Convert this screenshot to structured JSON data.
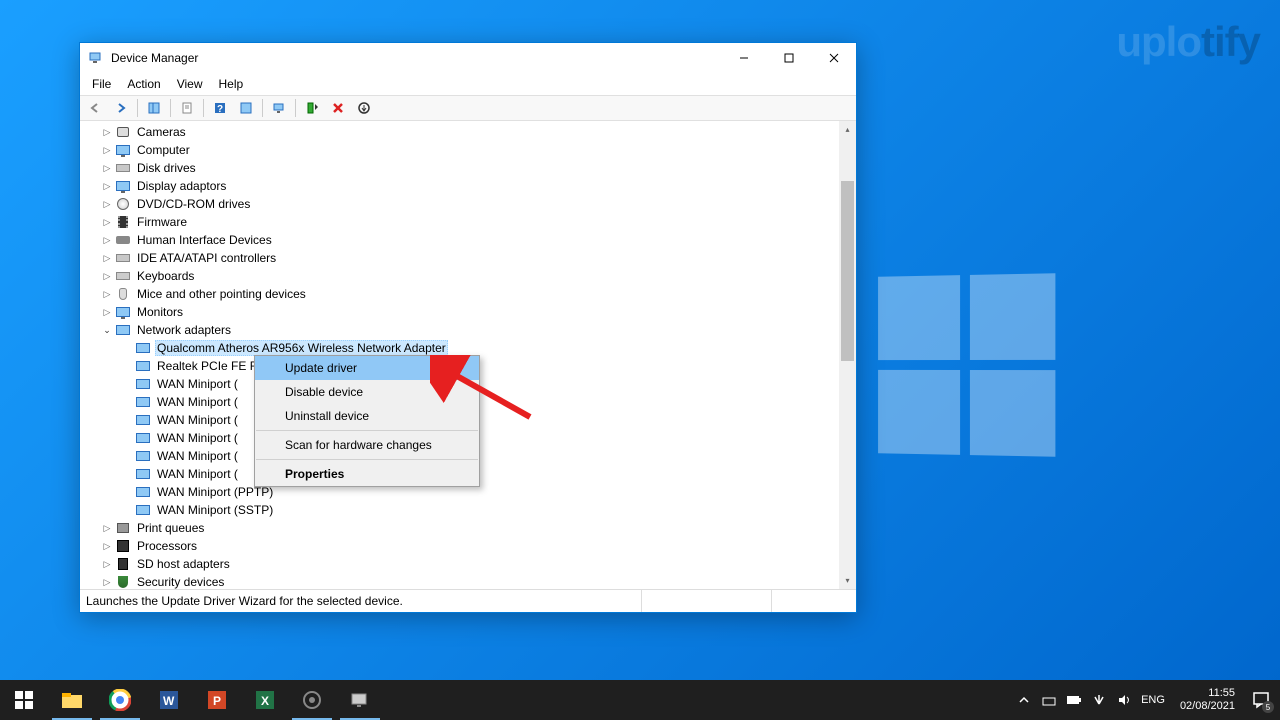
{
  "watermark_a": "uplo",
  "watermark_b": "tify",
  "window": {
    "title": "Device Manager"
  },
  "menu": {
    "file": "File",
    "action": "Action",
    "view": "View",
    "help": "Help"
  },
  "tree": {
    "cameras": "Cameras",
    "computer": "Computer",
    "disk_drives": "Disk drives",
    "display_adaptors": "Display adaptors",
    "dvd": "DVD/CD-ROM drives",
    "firmware": "Firmware",
    "hid": "Human Interface Devices",
    "ide": "IDE ATA/ATAPI controllers",
    "keyboards": "Keyboards",
    "mice": "Mice and other pointing devices",
    "monitors": "Monitors",
    "network": "Network adapters",
    "net_qualcomm": "Qualcomm Atheros AR956x Wireless Network Adapter",
    "net_realtek": "Realtek PCIe FE F",
    "net_wan1": "WAN Miniport (",
    "net_wan2": "WAN Miniport (",
    "net_wan3": "WAN Miniport (",
    "net_wan4": "WAN Miniport (",
    "net_wan5": "WAN Miniport (",
    "net_wan6": "WAN Miniport (",
    "net_wan_pptp": "WAN Miniport (PPTP)",
    "net_wan_sstp": "WAN Miniport (SSTP)",
    "print_queues": "Print queues",
    "processors": "Processors",
    "sd_host": "SD host adapters",
    "security": "Security devices"
  },
  "context": {
    "update": "Update driver",
    "disable": "Disable device",
    "uninstall": "Uninstall device",
    "scan": "Scan for hardware changes",
    "properties": "Properties"
  },
  "status": "Launches the Update Driver Wizard for the selected device.",
  "tray": {
    "lang": "ENG",
    "time": "11:55",
    "date": "02/08/2021",
    "notif_count": "5"
  }
}
